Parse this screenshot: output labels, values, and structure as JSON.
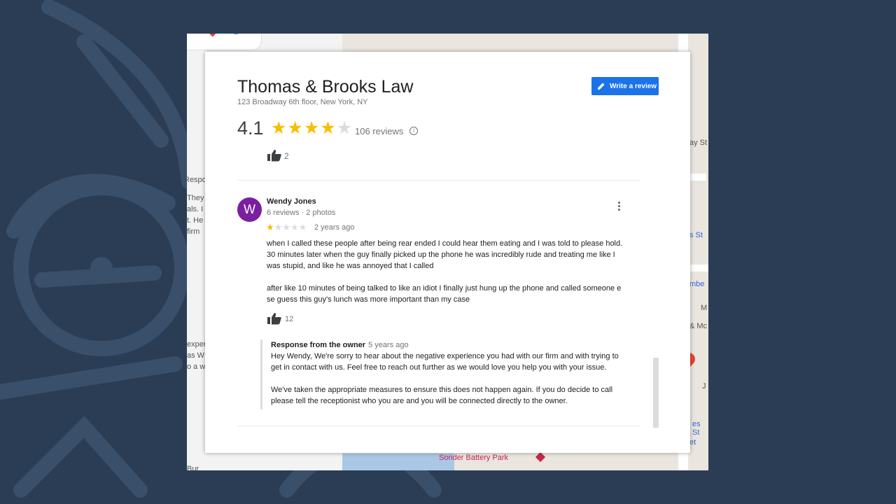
{
  "maps_background": {
    "snippets": [
      "Respo",
      "They a",
      "als. I",
      "t. He s",
      "firm",
      "exper",
      "as W",
      "o a w"
    ],
    "map_labels": [
      "ay St",
      "s St",
      "mbe",
      "M",
      "& Mc",
      "J",
      "es St",
      "et",
      "Bur"
    ],
    "poi": "Sonder Battery Park"
  },
  "business": {
    "name": "Thomas & Brooks Law",
    "address": "123 Broadway 6th floor, New York, NY",
    "write_review_label": "Write a review",
    "rating": "4.1",
    "stars_filled": 4,
    "stars_total": 5,
    "review_count": "106 reviews",
    "top_like_count": "2"
  },
  "review": {
    "avatar_initial": "W",
    "avatar_color": "#7b1fa2",
    "author": "Wendy Jones",
    "meta": "6 reviews · 2 photos",
    "stars_filled": 1,
    "time": "2 years ago",
    "text_p1_line1": "when I called these people after being rear ended I could hear them eating and I was told to please hold.",
    "text_p1_line2": "30 minutes later when the guy finally picked up the phone he was incredibly rude and treating me like I",
    "text_p1_line3": "was stupid, and like he was annoyed that I called",
    "text_p2_line1": "after like 10 minutes of being talked to like an idiot I finally just hung up the phone and called someone e",
    "text_p2_line2": "se guess this guy's lunch was more important than my case",
    "like_count": "12"
  },
  "owner_response": {
    "label": "Response from the owner",
    "time": "5 years ago",
    "p1_line1": "Hey Wendy, We're sorry to hear about the negative experience you had with our firm and with trying to",
    "p1_line2": "get in contact with us. Feel free to reach out further as we would love you help you with your issue.",
    "p2_line1": "We've taken the appropriate measures to ensure this does not happen again. If you do decide to call",
    "p2_line2": "please tell the receptionist who you are and you will be connected directly to the owner."
  },
  "colors": {
    "page_bg": "#2a3d55",
    "star": "#fbbc04",
    "button": "#1a73e8"
  }
}
